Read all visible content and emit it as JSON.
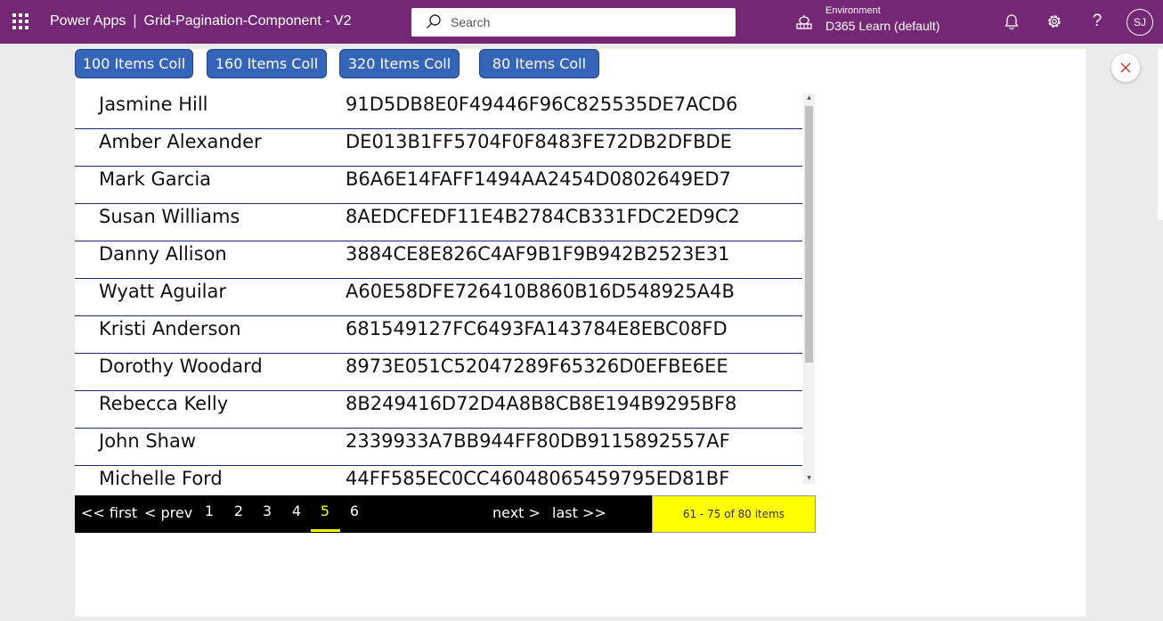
{
  "header": {
    "app_name": "Power Apps",
    "separator": "|",
    "app_title": "Grid-Pagination-Component - V2",
    "search_placeholder": "Search",
    "environment_label": "Environment",
    "environment_name": "D365 Learn (default)",
    "help_label": "?",
    "user_initials": "SJ",
    "theme_color": "#742774"
  },
  "collection_buttons": [
    {
      "label": "100 Items Coll"
    },
    {
      "label": "160 Items Coll"
    },
    {
      "label": "320 Items Coll"
    },
    {
      "label": "80 Items Coll"
    }
  ],
  "gallery": {
    "rows": [
      {
        "name": "Jasmine Hill",
        "id": "91D5DB8E0F49446F96C825535DE7ACD6"
      },
      {
        "name": "Amber Alexander",
        "id": "DE013B1FF5704F0F8483FE72DB2DFBDE"
      },
      {
        "name": "Mark Garcia",
        "id": "B6A6E14FAFF1494AA2454D0802649ED7"
      },
      {
        "name": "Susan Williams",
        "id": "8AEDCFEDF11E4B2784CB331FDC2ED9C2"
      },
      {
        "name": "Danny Allison",
        "id": "3884CE8E826C4AF9B1F9B942B2523E31"
      },
      {
        "name": "Wyatt Aguilar",
        "id": "A60E58DFE726410B860B16D548925A4B"
      },
      {
        "name": "Kristi Anderson",
        "id": "681549127FC6493FA143784E8EBC08FD"
      },
      {
        "name": "Dorothy Woodard",
        "id": "8973E051C52047289F65326D0EFBE6EE"
      },
      {
        "name": "Rebecca Kelly",
        "id": "8B249416D72D4A8B8CB8E194B9295BF8"
      },
      {
        "name": "John Shaw",
        "id": "2339933A7BB944FF80DB9115892557AF"
      },
      {
        "name": "Michelle Ford",
        "id": "44FF585EC0CC46048065459795ED81BF"
      }
    ]
  },
  "pagination": {
    "first_label": "<< first",
    "prev_label": "< prev",
    "next_label": "next >",
    "last_label": "last >>",
    "pages": [
      "1",
      "2",
      "3",
      "4",
      "5",
      "6"
    ],
    "current_page": "5",
    "info_text": "61 - 75 of 80 items",
    "accent_color": "#ffff00"
  },
  "icons": {
    "app_launcher": "waffle-icon",
    "search": "search-icon",
    "environment": "environment-icon",
    "notifications": "bell-icon",
    "settings": "gear-icon",
    "close": "close-icon"
  }
}
